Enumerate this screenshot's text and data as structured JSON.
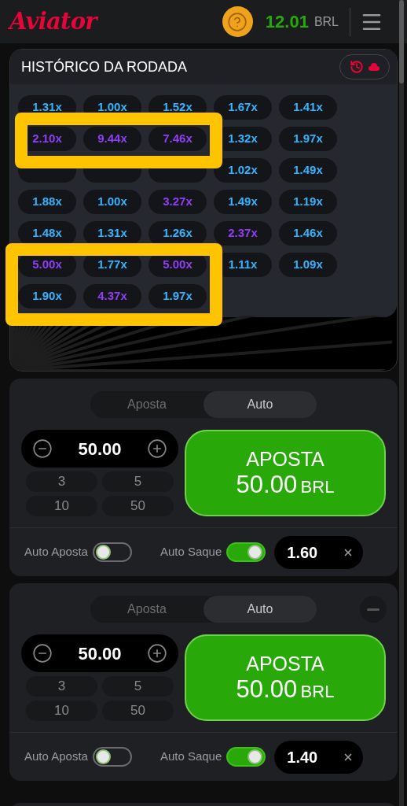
{
  "header": {
    "logo": "Aviator",
    "balance": "12.01",
    "currency": "BRL"
  },
  "history": {
    "title": "HISTÓRICO DA RODADA",
    "multipliers": [
      {
        "value": "1.31x",
        "color": "#34b4ff"
      },
      {
        "value": "1.00x",
        "color": "#34b4ff"
      },
      {
        "value": "1.52x",
        "color": "#34b4ff"
      },
      {
        "value": "1.67x",
        "color": "#34b4ff"
      },
      {
        "value": "1.41x",
        "color": "#34b4ff"
      },
      {
        "value": "2.10x",
        "color": "#913ef8"
      },
      {
        "value": "9.44x",
        "color": "#913ef8"
      },
      {
        "value": "7.46x",
        "color": "#913ef8"
      },
      {
        "value": "1.32x",
        "color": "#34b4ff"
      },
      {
        "value": "1.97x",
        "color": "#34b4ff"
      },
      {
        "kind": "covered"
      },
      {
        "kind": "covered"
      },
      {
        "kind": "covered"
      },
      {
        "value": "1.02x",
        "color": "#34b4ff"
      },
      {
        "value": "1.49x",
        "color": "#34b4ff"
      },
      {
        "value": "1.88x",
        "color": "#34b4ff"
      },
      {
        "value": "1.00x",
        "color": "#34b4ff"
      },
      {
        "value": "3.27x",
        "color": "#913ef8"
      },
      {
        "value": "1.49x",
        "color": "#34b4ff"
      },
      {
        "value": "1.19x",
        "color": "#34b4ff"
      },
      {
        "value": "1.48x",
        "color": "#34b4ff"
      },
      {
        "value": "1.31x",
        "color": "#34b4ff"
      },
      {
        "value": "1.26x",
        "color": "#34b4ff"
      },
      {
        "value": "2.37x",
        "color": "#913ef8"
      },
      {
        "value": "1.46x",
        "color": "#34b4ff"
      },
      {
        "value": "5.00x",
        "color": "#913ef8"
      },
      {
        "value": "1.77x",
        "color": "#34b4ff"
      },
      {
        "value": "5.00x",
        "color": "#913ef8"
      },
      {
        "value": "1.11x",
        "color": "#34b4ff"
      },
      {
        "value": "1.09x",
        "color": "#34b4ff"
      },
      {
        "value": "1.90x",
        "color": "#34b4ff"
      },
      {
        "value": "4.37x",
        "color": "#913ef8"
      },
      {
        "value": "1.97x",
        "color": "#34b4ff"
      }
    ]
  },
  "highlight_frames": [
    {
      "color": "#ffc400"
    },
    {
      "color": "#ffc400"
    }
  ],
  "bets": [
    {
      "tabs": [
        {
          "label": "Aposta",
          "selected": false
        },
        {
          "label": "Auto",
          "selected": true
        }
      ],
      "has_remove_button": false,
      "amount": "50.00",
      "quick_amounts": [
        "3",
        "5",
        "10",
        "50"
      ],
      "button": {
        "label": "APOSTA",
        "amount": "50.00",
        "currency": "BRL"
      },
      "auto_bet": {
        "label": "Auto Aposta",
        "on": false
      },
      "auto_cashout": {
        "label": "Auto Saque",
        "on": true,
        "value": "1.60"
      }
    },
    {
      "tabs": [
        {
          "label": "Aposta",
          "selected": false
        },
        {
          "label": "Auto",
          "selected": true
        }
      ],
      "has_remove_button": true,
      "amount": "50.00",
      "quick_amounts": [
        "3",
        "5",
        "10",
        "50"
      ],
      "button": {
        "label": "APOSTA",
        "amount": "50.00",
        "currency": "BRL"
      },
      "auto_bet": {
        "label": "Auto Aposta",
        "on": false
      },
      "auto_cashout": {
        "label": "Auto Saque",
        "on": true,
        "value": "1.40"
      }
    }
  ]
}
